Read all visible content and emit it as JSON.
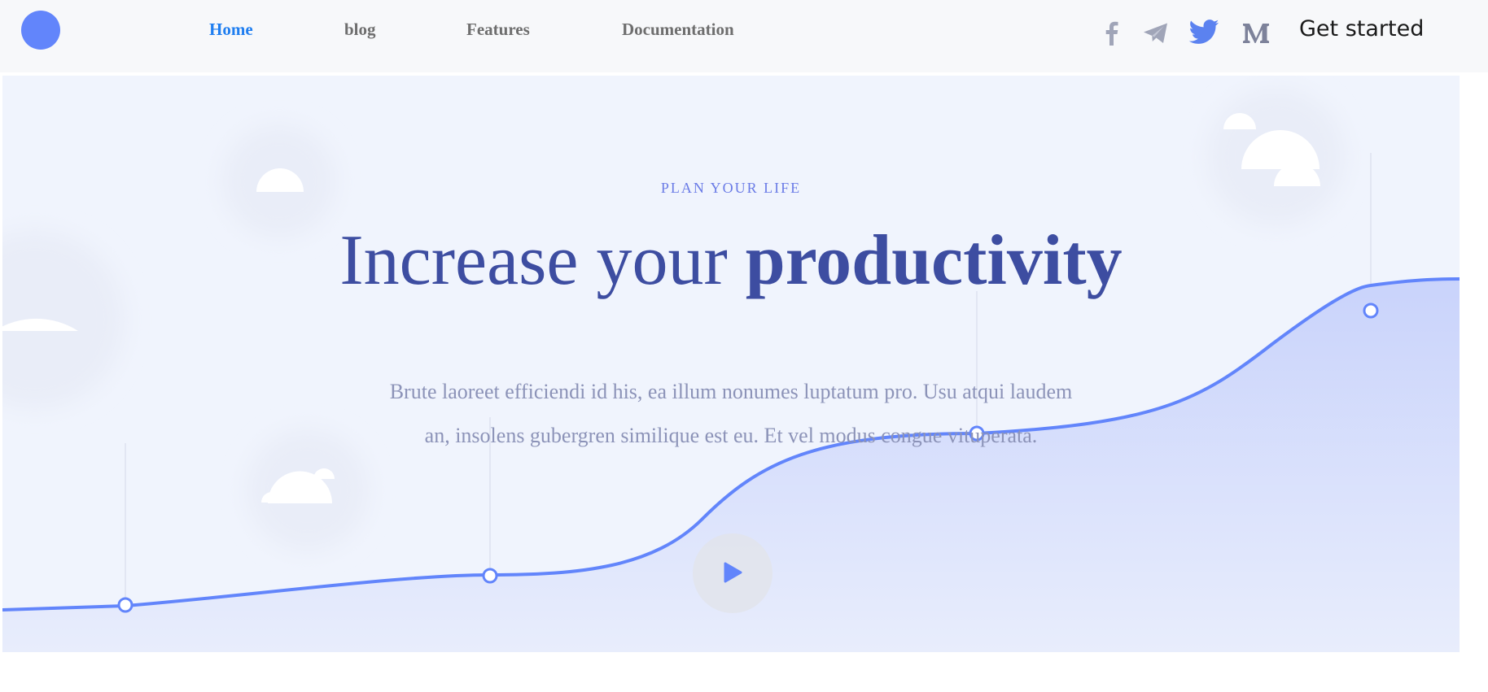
{
  "header": {
    "logo": "brand-logo-circle",
    "nav": [
      {
        "label": "Home",
        "active": true
      },
      {
        "label": "blog",
        "active": false
      },
      {
        "label": "Features",
        "active": false
      },
      {
        "label": "Documentation",
        "active": false
      }
    ],
    "social_icons": [
      "facebook-icon",
      "telegram-icon",
      "twitter-icon",
      "medium-icon"
    ],
    "cta_label": "Get started"
  },
  "hero": {
    "eyebrow": "PLAN YOUR LIFE",
    "headline_regular": "Increase your",
    "headline_bold": "productivity",
    "description": "Brute laoreet efficiendi id his, ea illum nonumes luptatum pro. Usu atqui laudem an, insolens gubergren similique est eu. Et vel modus congue vituperata.",
    "play_icon": "play-icon"
  },
  "colors": {
    "accent": "#6285fb",
    "nav_active": "#1f7ef0",
    "nav_inactive": "#6e6e6e",
    "headline": "#3d4da1",
    "eyebrow": "#6a7be6",
    "body_text": "#8c93b8",
    "hero_bg": "#f0f4fd",
    "header_bg": "#f7f8fa",
    "twitter": "#5b82f0",
    "social_muted": "#a0a5b8"
  }
}
